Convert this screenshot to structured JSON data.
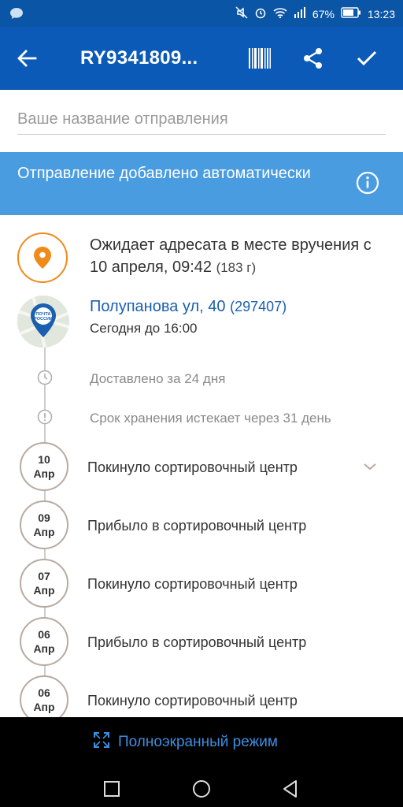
{
  "statusbar": {
    "battery": "67%",
    "time": "13:23"
  },
  "appbar": {
    "title": "RY9341809..."
  },
  "name_field": {
    "placeholder": "Ваше название отправления"
  },
  "banner": {
    "text": "Отправление добавлено автоматически"
  },
  "status": {
    "text": "Ожидает адресата в месте вручения с 10 апреля, 09:42",
    "weight": "(183 г)"
  },
  "office": {
    "name": "Полупанова ул, 40",
    "zip": "(297407)",
    "hours": "Сегодня до 16:00",
    "logo_text": "ПОЧТА РОССИИ"
  },
  "info": {
    "delivered": "Доставлено за 24 дня",
    "storage": "Срок хранения истекает через 31 день"
  },
  "events": [
    {
      "day": "10",
      "month": "Апр",
      "label": "Покинуло сортировочный центр"
    },
    {
      "day": "09",
      "month": "Апр",
      "label": "Прибыло в сортировочный центр"
    },
    {
      "day": "07",
      "month": "Апр",
      "label": "Покинуло сортировочный центр"
    },
    {
      "day": "06",
      "month": "Апр",
      "label": "Прибыло в сортировочный центр"
    },
    {
      "day": "06",
      "month": "Апр",
      "label": "Покинуло сортировочный центр"
    }
  ],
  "bottom": {
    "fullscreen": "Полноэкранный режим"
  },
  "colors": {
    "appbar": "#0b5ab8",
    "banner": "#4a9ce0",
    "accent": "#f08a1a",
    "link": "#1a5fb0"
  }
}
